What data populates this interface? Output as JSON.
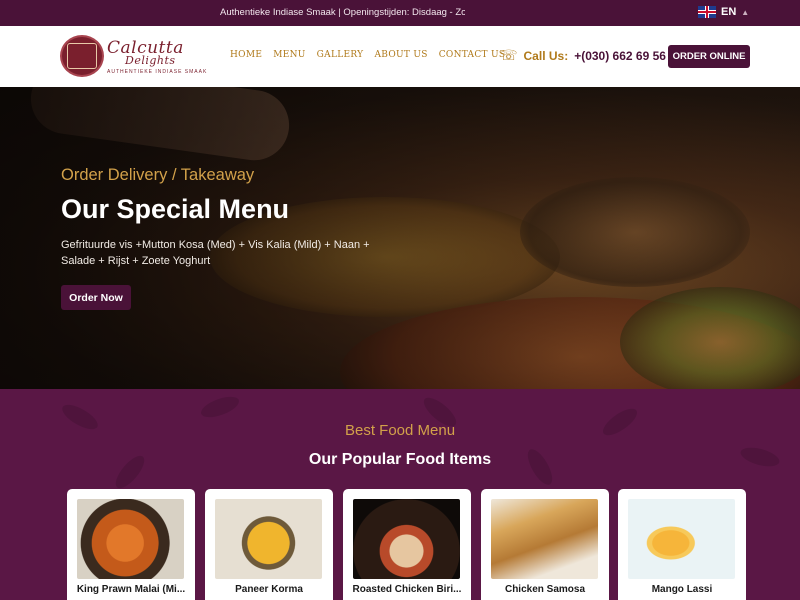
{
  "topbar": {
    "announcement": "Authentieke Indiase Smaak | Openingstijden: Disdaag - Zondag : (",
    "language": "EN"
  },
  "header": {
    "logo_name": "Calcutta",
    "logo_name_2": "Delights",
    "logo_tagline": "AUTHENTIEKE INDIASE SMAAK",
    "nav": [
      "HOME",
      "MENU",
      "GALLERY",
      "ABOUT US",
      "CONTACT US"
    ],
    "call_label": "Call Us:",
    "call_number": "+(030) 662 69 56",
    "order_button": "ORDER ONLINE"
  },
  "hero": {
    "subtitle": "Order Delivery / Takeaway",
    "title": "Our Special Menu",
    "description": "Gefrituurde vis +Mutton Kosa (Med) + Vis Kalia (Mild) + Naan + Salade + Rijst + Zoete Yoghurt",
    "button": "Order Now"
  },
  "menu": {
    "subtitle": "Best Food Menu",
    "title": "Our Popular Food Items",
    "items": [
      {
        "name": "King Prawn Malai (Mi..."
      },
      {
        "name": "Paneer Korma"
      },
      {
        "name": "Roasted Chicken Biri..."
      },
      {
        "name": "Chicken Samosa"
      },
      {
        "name": "Mango Lassi"
      }
    ]
  },
  "icons": {
    "phone": "phone-icon",
    "flag": "uk-flag-icon",
    "chevron": "chevron-down-icon"
  },
  "colors": {
    "brand": "#4a1238",
    "gold": "#d2a14a",
    "nav_gold": "#b07a1b"
  }
}
